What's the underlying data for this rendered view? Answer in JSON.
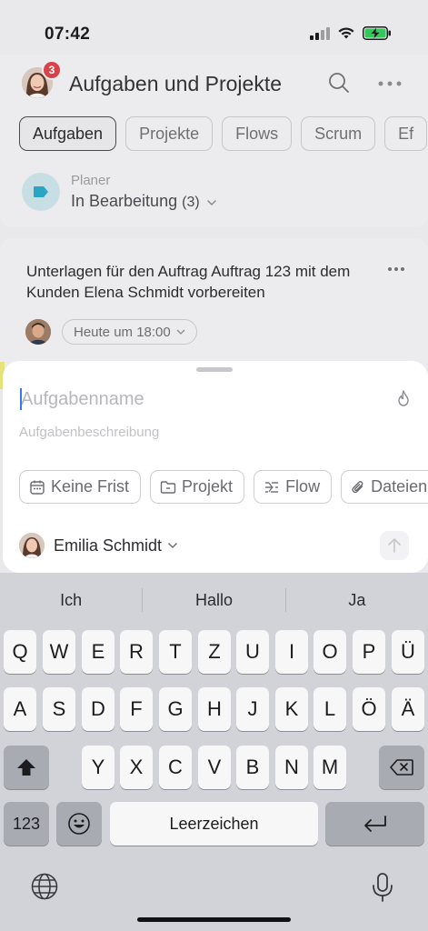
{
  "status_bar": {
    "time": "07:42"
  },
  "header": {
    "title": "Aufgaben und Projekte",
    "notification_count": "3",
    "tabs": [
      {
        "label": "Aufgaben",
        "active": true
      },
      {
        "label": "Projekte",
        "active": false
      },
      {
        "label": "Flows",
        "active": false
      },
      {
        "label": "Scrum",
        "active": false
      },
      {
        "label": "Ef",
        "active": false
      }
    ],
    "planer_label": "Planer",
    "planer_value": "In Bearbeitung",
    "planer_count": "(3)"
  },
  "task_card": {
    "title": "Unterlagen für den Auftrag Auftrag 123 mit dem Kunden Elena  Schmidt vorbereiten",
    "due": "Heute um 18:00"
  },
  "sheet": {
    "name_placeholder": "Aufgabenname",
    "description_placeholder": "Aufgabenbeschreibung",
    "chips": {
      "deadline": "Keine Frist",
      "project": "Projekt",
      "flow": "Flow",
      "files": "Dateien"
    },
    "responsible": "Emilia Schmidt"
  },
  "keyboard": {
    "suggestions": [
      "Ich",
      "Hallo",
      "Ja"
    ],
    "row1": [
      "Q",
      "W",
      "E",
      "R",
      "T",
      "Z",
      "U",
      "I",
      "O",
      "P",
      "Ü"
    ],
    "row2": [
      "A",
      "S",
      "D",
      "F",
      "G",
      "H",
      "J",
      "K",
      "L",
      "Ö",
      "Ä"
    ],
    "row3": [
      "Y",
      "X",
      "C",
      "V",
      "B",
      "N",
      "M"
    ],
    "numbers_key": "123",
    "space_key": "Leerzeichen"
  },
  "colors": {
    "accent": "#3478f6",
    "badge": "#d8434a",
    "planer_icon": "#2aa6c4"
  }
}
